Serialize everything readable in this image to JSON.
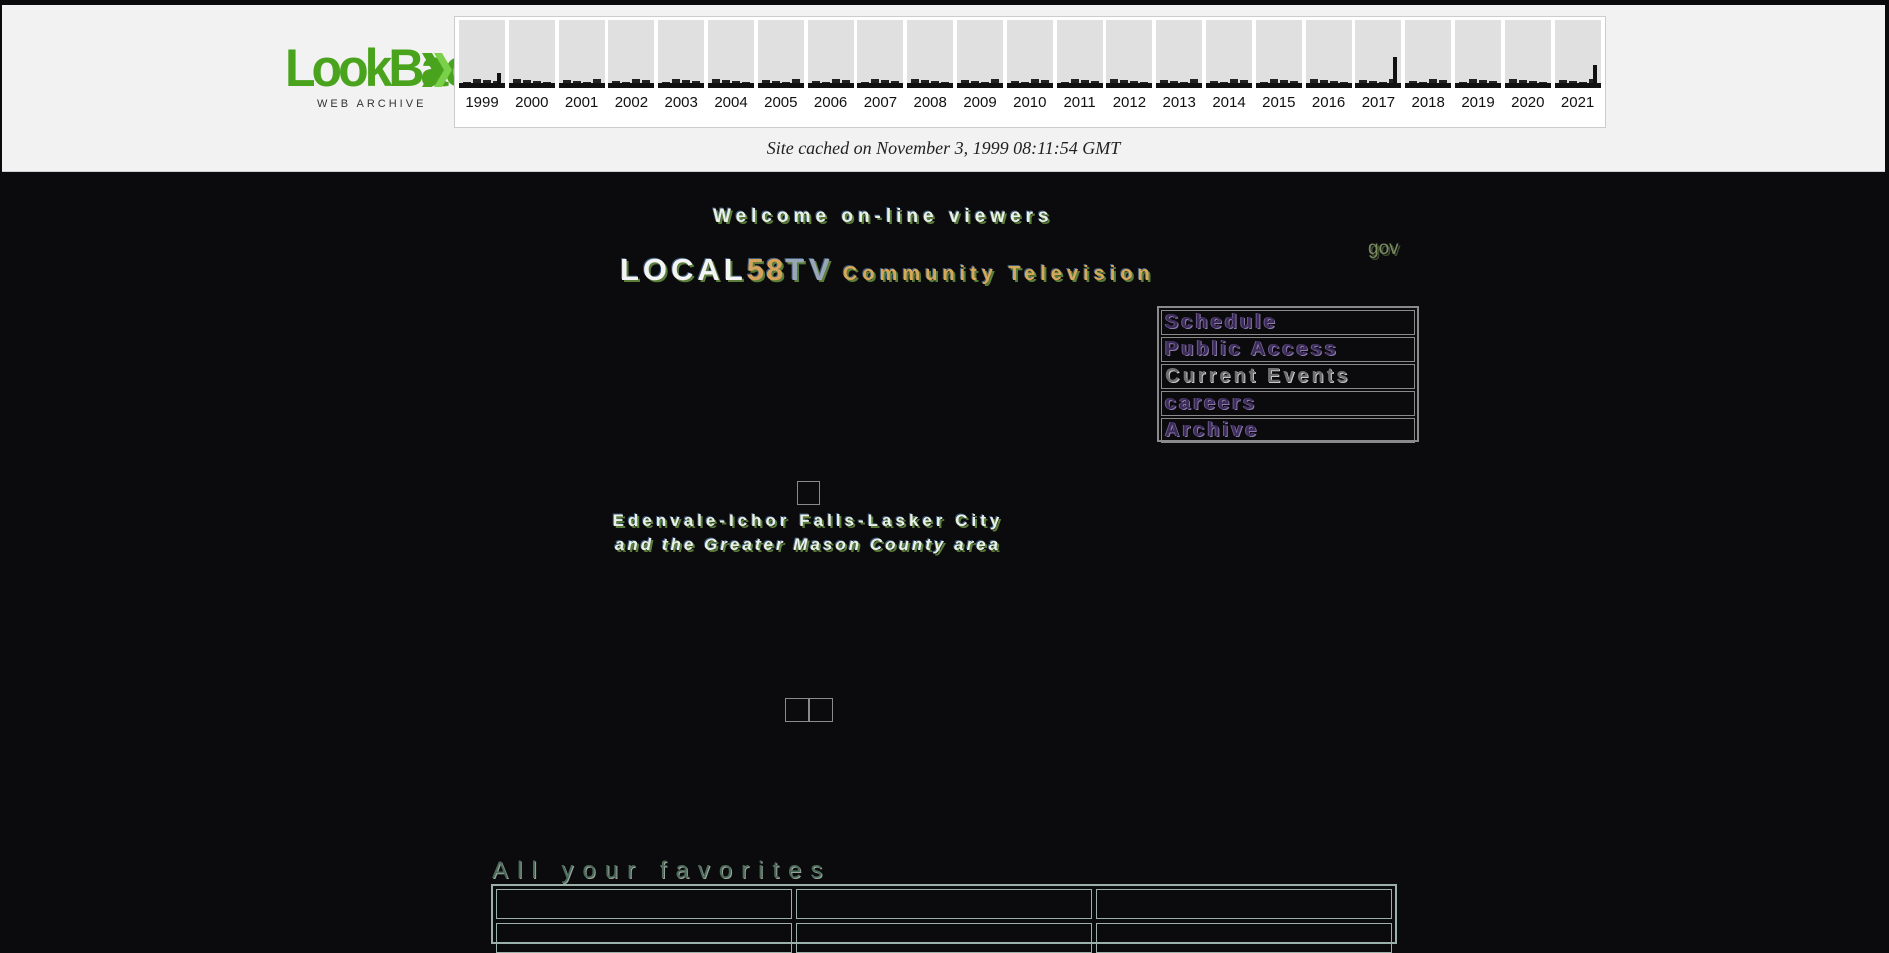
{
  "banner": {
    "logo_text": "LookBack",
    "logo_sub": "WEB ARCHIVE",
    "years": [
      "1999",
      "2000",
      "2001",
      "2002",
      "2003",
      "2004",
      "2005",
      "2006",
      "2007",
      "2008",
      "2009",
      "2010",
      "2011",
      "2012",
      "2013",
      "2014",
      "2015",
      "2016",
      "2017",
      "2018",
      "2019",
      "2020",
      "2021"
    ],
    "cached_text": "Site cached on November 3, 1999 08:11:54 GMT",
    "accent_color": "#4aa31c"
  },
  "page": {
    "welcome": "Welcome on-line viewers",
    "title_local": "LOCAL",
    "title_num": "58",
    "title_tv": "TV",
    "title_tagline": "Community Television",
    "gov": "gov",
    "nav": [
      "Schedule",
      "Public Access",
      "Current Events",
      "careers",
      "Archive"
    ],
    "towns_line1": "Edenvale-Ichor Falls-Lasker City",
    "towns_line2": "and the Greater Mason County area",
    "favorites_heading": "All your favorites"
  }
}
